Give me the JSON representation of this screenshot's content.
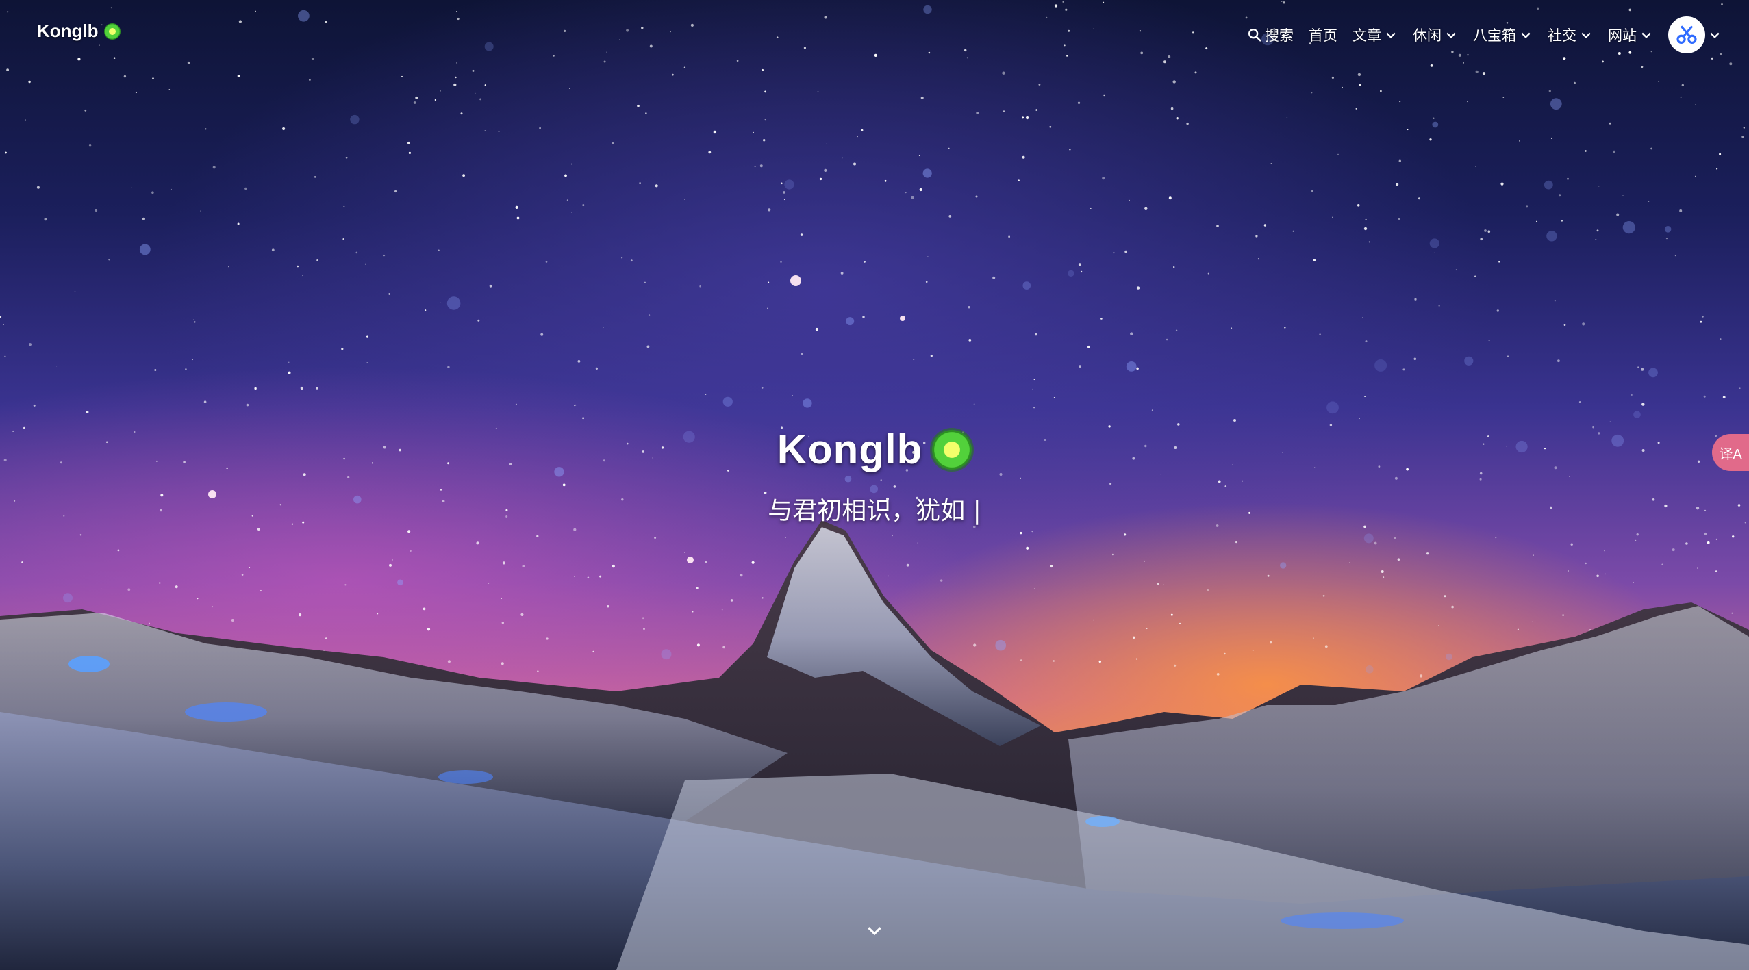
{
  "site": {
    "logo_text": "Konglb",
    "kiwi_icon": "kiwi-fruit-icon"
  },
  "nav": {
    "search_label": "搜索",
    "home_label": "首页",
    "articles_label": "文章",
    "leisure_label": "休闲",
    "treasure_label": "八宝箱",
    "social_label": "社交",
    "website_label": "网站",
    "avatar_icon": "scissors-icon"
  },
  "hero": {
    "title": "Konglb",
    "subtitle": "与君初相识，犹如",
    "cursor": "|"
  },
  "side_tab": {
    "translate_label": "译A",
    "icon": "translate-icon"
  },
  "colors": {
    "accent": "#e16a8a",
    "kiwi_green": "#52d13b",
    "avatar_blue": "#2f6bff"
  }
}
